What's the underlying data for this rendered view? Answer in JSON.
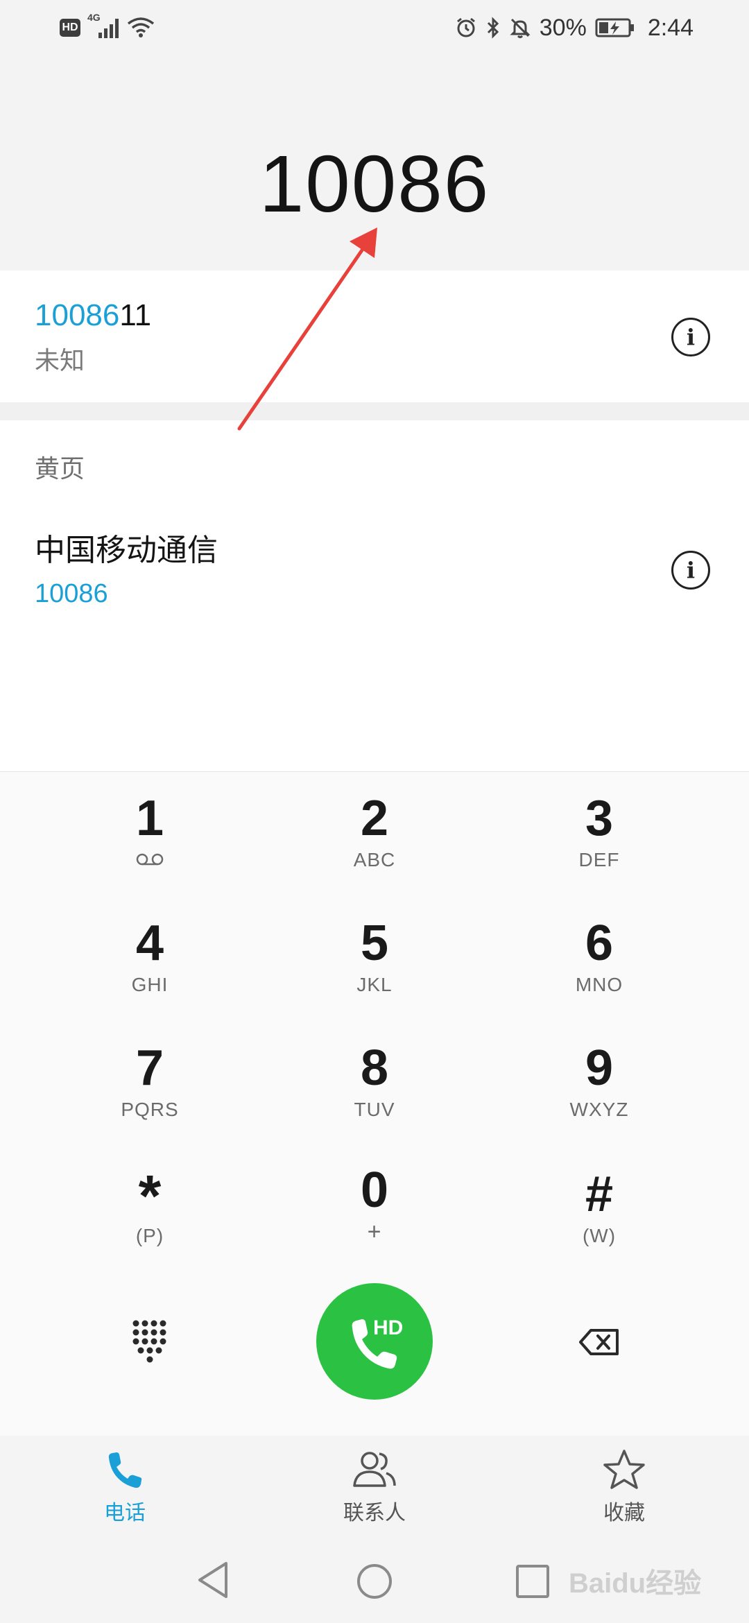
{
  "status_bar": {
    "hd": "HD",
    "network": "4G",
    "battery_percent": "30%",
    "time": "2:44"
  },
  "dialed_number": "10086",
  "suggestion": {
    "number_match": "10086",
    "number_rest": "11",
    "label": "未知"
  },
  "yellow_pages": {
    "title": "黄页",
    "name": "中国移动通信",
    "number": "10086"
  },
  "dialpad": {
    "keys": [
      {
        "digit": "1",
        "letters": ""
      },
      {
        "digit": "2",
        "letters": "ABC"
      },
      {
        "digit": "3",
        "letters": "DEF"
      },
      {
        "digit": "4",
        "letters": "GHI"
      },
      {
        "digit": "5",
        "letters": "JKL"
      },
      {
        "digit": "6",
        "letters": "MNO"
      },
      {
        "digit": "7",
        "letters": "PQRS"
      },
      {
        "digit": "8",
        "letters": "TUV"
      },
      {
        "digit": "9",
        "letters": "WXYZ"
      },
      {
        "digit": "*",
        "letters": "(P)"
      },
      {
        "digit": "0",
        "letters": "+"
      },
      {
        "digit": "#",
        "letters": "(W)"
      }
    ],
    "call_badge": "HD"
  },
  "tabs": [
    {
      "label": "电话",
      "icon": "phone-icon",
      "active": true
    },
    {
      "label": "联系人",
      "icon": "contacts-icon",
      "active": false
    },
    {
      "label": "收藏",
      "icon": "star-icon",
      "active": false
    }
  ],
  "colors": {
    "accent": "#1aa0d6",
    "call_green": "#2bc243",
    "annotation_red": "#e8403a"
  },
  "watermark": "Baidu经验"
}
